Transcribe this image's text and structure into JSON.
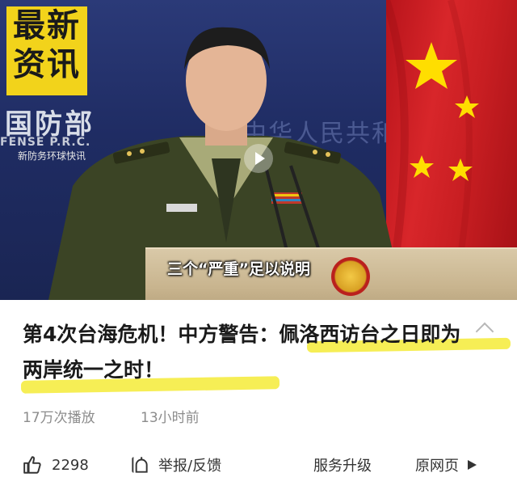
{
  "video": {
    "badge_line1": "最新",
    "badge_line2": "资讯",
    "ministry_label": "国防部",
    "ministry_en": "FENSE P.R.C.",
    "backdrop_text": "中华人民共和国国防部",
    "watermark": "新防务环球快讯",
    "caption": "三个“严重”足以说明"
  },
  "article": {
    "title": "第4次台海危机！中方警告：佩洛西访台之日即为两岸统一之时！",
    "play_count": "17万次播放",
    "time_ago": "13小时前"
  },
  "toolbar": {
    "like_count": "2298",
    "report_label": "举报/反馈",
    "service_label": "服务升级",
    "original_label": "原网页"
  },
  "colors": {
    "highlight": "#f6ee55",
    "badge": "#f2d31b",
    "flag_red": "#d8262a",
    "text_dark": "#1a1a1a",
    "text_meta": "#8c8c8c"
  },
  "icons": [
    "thumbs-up-icon",
    "report-icon",
    "play-triangle-icon",
    "collapse-chevron-icon",
    "video-play-icon"
  ]
}
